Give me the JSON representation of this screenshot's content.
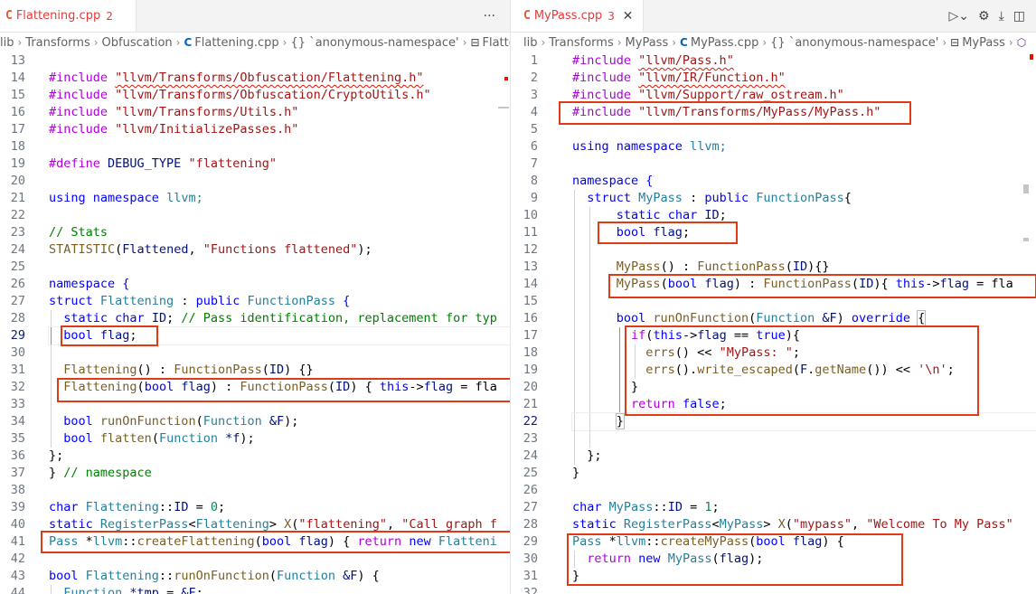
{
  "left": {
    "tab": {
      "icon": "C",
      "name": "Flattening.cpp",
      "count": "2",
      "more": "···"
    },
    "breadcrumb": [
      "lib",
      "Transforms",
      "Obfuscation",
      "Flattening.cpp",
      "{} `anonymous-namespace'",
      "Flatten"
    ],
    "line_numbers": [
      "13",
      "14",
      "15",
      "16",
      "17",
      "18",
      "19",
      "20",
      "21",
      "22",
      "23",
      "24",
      "25",
      "26",
      "27",
      "28",
      "29",
      "30",
      "31",
      "32",
      "33",
      "34",
      "35",
      "36",
      "37",
      "38",
      "39",
      "40",
      "41",
      "42",
      "43",
      "44"
    ],
    "active_line": "29",
    "lines": {
      "l14a": "#include ",
      "l14b": "\"llvm/Transforms/Obfuscation/Flattening.h\"",
      "l15a": "#include ",
      "l15b": "\"llvm/Transforms/Obfuscation/CryptoUtils.h\"",
      "l16a": "#include ",
      "l16b": "\"llvm/Transforms/Utils.h\"",
      "l17a": "#include ",
      "l17b": "\"llvm/InitializePasses.h\"",
      "l19a": "#define ",
      "l19b": "DEBUG_TYPE ",
      "l19c": "\"flattening\"",
      "l21a": "using ",
      "l21b": "namespace ",
      "l21c": "llvm;",
      "l23": "// Stats",
      "l24a": "STATISTIC",
      "l24b": "(",
      "l24c": "Flattened",
      "l24d": ", ",
      "l24e": "\"Functions flattened\"",
      "l24f": ");",
      "l26a": "namespace ",
      "l26b": "{",
      "l27a": "struct ",
      "l27b": "Flattening",
      "l27c": " : ",
      "l27d": "public ",
      "l27e": "FunctionPass",
      "l27f": " {",
      "l28a": "static ",
      "l28b": "char ",
      "l28c": "ID",
      "l28d": "; ",
      "l28e": "// Pass identification, replacement for typ",
      "l29a": "bool ",
      "l29b": "flag",
      "l29c": ";",
      "l31a": "Flattening",
      "l31b": "() : ",
      "l31c": "FunctionPass",
      "l31d": "(",
      "l31e": "ID",
      "l31f": ") {}",
      "l32a": "Flattening",
      "l32b": "(",
      "l32c": "bool ",
      "l32d": "flag",
      "l32e": ") : ",
      "l32f": "FunctionPass",
      "l32g": "(",
      "l32h": "ID",
      "l32i": ") { ",
      "l32j": "this",
      "l32k": "->",
      "l32l": "flag",
      "l32m": " = fla",
      "l34a": "bool ",
      "l34b": "runOnFunction",
      "l34c": "(",
      "l34d": "Function ",
      "l34e": "&F",
      "l34f": ");",
      "l35a": "bool ",
      "l35b": "flatten",
      "l35c": "(",
      "l35d": "Function ",
      "l35e": "*f",
      "l35f": ");",
      "l36": "};",
      "l37a": "} ",
      "l37b": "// namespace",
      "l39a": "char ",
      "l39b": "Flattening",
      "l39c": "::",
      "l39d": "ID",
      "l39e": " = ",
      "l39f": "0",
      "l39g": ";",
      "l40a": "static ",
      "l40b": "RegisterPass",
      "l40c": "<",
      "l40d": "Flattening",
      "l40e": "> ",
      "l40f": "X",
      "l40g": "(",
      "l40h": "\"flattening\"",
      "l40i": ", ",
      "l40j": "\"Call graph f",
      "l41a": "Pass ",
      "l41b": "*",
      "l41c": "llvm",
      "l41d": "::",
      "l41e": "createFlattening",
      "l41f": "(",
      "l41g": "bool ",
      "l41h": "flag",
      "l41i": ") { ",
      "l41j": "return ",
      "l41k": "new ",
      "l41l": "Flatteni",
      "l43a": "bool ",
      "l43b": "Flattening",
      "l43c": "::",
      "l43d": "runOnFunction",
      "l43e": "(",
      "l43f": "Function ",
      "l43g": "&F",
      "l43h": ") {",
      "l44a": "Function ",
      "l44b": "*tmp",
      "l44c": " = ",
      "l44d": "&F",
      "l44e": ";"
    }
  },
  "right": {
    "tab": {
      "icon": "C",
      "name": "MyPass.cpp",
      "count": "3",
      "close": "✕"
    },
    "breadcrumb": [
      "lib",
      "Transforms",
      "MyPass",
      "MyPass.cpp",
      "{} `anonymous-namespace'",
      "MyPass"
    ],
    "line_numbers": [
      "1",
      "2",
      "3",
      "4",
      "5",
      "6",
      "7",
      "8",
      "9",
      "10",
      "11",
      "12",
      "13",
      "14",
      "15",
      "16",
      "17",
      "18",
      "19",
      "20",
      "21",
      "22",
      "23",
      "24",
      "25",
      "26",
      "27",
      "28",
      "29",
      "30",
      "31",
      "32"
    ],
    "active_line": "22",
    "lines": {
      "r1a": "#include ",
      "r1b": "\"llvm/Pass.h\"",
      "r2a": "#include ",
      "r2b": "\"llvm/IR/Function.h\"",
      "r3a": "#include ",
      "r3b": "\"llvm/Support/raw_ostream.h\"",
      "r4a": "#include ",
      "r4b": "\"llvm/Transforms/MyPass/MyPass.h\"",
      "r6a": "using ",
      "r6b": "namespace ",
      "r6c": "llvm;",
      "r8a": "namespace ",
      "r8b": "{",
      "r9a": "struct ",
      "r9b": "MyPass",
      "r9c": " : ",
      "r9d": "public ",
      "r9e": "FunctionPass",
      "r9f": "{",
      "r10a": "static ",
      "r10b": "char ",
      "r10c": "ID",
      "r10d": ";",
      "r11a": "bool ",
      "r11b": "flag",
      "r11c": ";",
      "r13a": "MyPass",
      "r13b": "() : ",
      "r13c": "FunctionPass",
      "r13d": "(",
      "r13e": "ID",
      "r13f": "){}",
      "r14a": "MyPass",
      "r14b": "(",
      "r14c": "bool ",
      "r14d": "flag",
      "r14e": ") : ",
      "r14f": "FunctionPass",
      "r14g": "(",
      "r14h": "ID",
      "r14i": "){ ",
      "r14j": "this",
      "r14k": "->",
      "r14l": "flag",
      "r14m": " = fla",
      "r16a": "bool ",
      "r16b": "runOnFunction",
      "r16c": "(",
      "r16d": "Function ",
      "r16e": "&F",
      "r16f": ") ",
      "r16g": "override ",
      "r16h": "{",
      "r17a": "if",
      "r17b": "(",
      "r17c": "this",
      "r17d": "->",
      "r17e": "flag",
      "r17f": " == ",
      "r17g": "true",
      "r17h": "){",
      "r18a": "errs",
      "r18b": "() << ",
      "r18c": "\"MyPass: \"",
      "r18d": ";",
      "r19a": "errs",
      "r19b": "().",
      "r19c": "write_escaped",
      "r19d": "(",
      "r19e": "F",
      "r19f": ".",
      "r19g": "getName",
      "r19h": "()) << ",
      "r19i": "'\\n'",
      "r19j": ";",
      "r20": "}",
      "r21a": "return ",
      "r21b": "false",
      "r21c": ";",
      "r22": "}",
      "r24": "};",
      "r25": "}",
      "r27a": "char ",
      "r27b": "MyPass",
      "r27c": "::",
      "r27d": "ID",
      "r27e": " = ",
      "r27f": "1",
      "r27g": ";",
      "r28a": "static ",
      "r28b": "RegisterPass",
      "r28c": "<",
      "r28d": "MyPass",
      "r28e": "> ",
      "r28f": "X",
      "r28g": "(",
      "r28h": "\"mypass\"",
      "r28i": ", ",
      "r28j": "\"Welcome To My Pass\"",
      "r29a": "Pass ",
      "r29b": "*",
      "r29c": "llvm",
      "r29d": "::",
      "r29e": "createMyPass",
      "r29f": "(",
      "r29g": "bool ",
      "r29h": "flag",
      "r29i": ") {",
      "r30a": "return ",
      "r30b": "new ",
      "r30c": "MyPass",
      "r30d": "(",
      "r30e": "flag",
      "r30f": ");",
      "r31": "}"
    }
  }
}
